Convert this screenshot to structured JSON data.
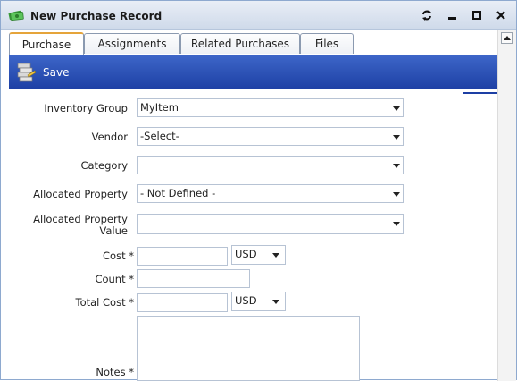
{
  "window": {
    "title": "New Purchase Record"
  },
  "tabs": [
    "Purchase",
    "Assignments",
    "Related Purchases",
    "Files"
  ],
  "toolbar": {
    "save_label": "Save"
  },
  "form": {
    "inventory_group": {
      "label": "Inventory Group",
      "value": "MyItem"
    },
    "vendor": {
      "label": "Vendor",
      "value": "-Select-"
    },
    "category": {
      "label": "Category",
      "value": ""
    },
    "allocated_property": {
      "label": "Allocated Property",
      "value": "- Not Defined -"
    },
    "allocated_property_value": {
      "label_line1": "Allocated Property",
      "label_line2": "Value",
      "value": ""
    },
    "cost": {
      "label": "Cost *",
      "value": "",
      "currency": "USD"
    },
    "count": {
      "label": "Count *",
      "value": ""
    },
    "total_cost": {
      "label": "Total Cost *",
      "value": "",
      "currency": "USD"
    },
    "notes": {
      "label": "Notes *",
      "value": ""
    }
  },
  "colors": {
    "toolbar": "#1d3fa4",
    "active_tab_accent": "#e5a43a"
  }
}
